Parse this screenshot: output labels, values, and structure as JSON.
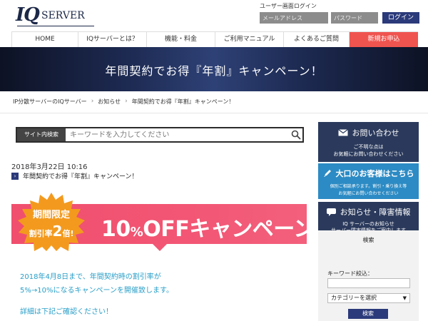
{
  "header": {
    "logo_iq": "IQ",
    "logo_server": "SERVER",
    "login_label": "ユーザー画面ログイン",
    "email_placeholder": "メールアドレス",
    "password_placeholder": "パスワード",
    "login_button": "ログイン"
  },
  "nav": {
    "items": [
      {
        "label": "HOME"
      },
      {
        "label": "IQサーバーとは？"
      },
      {
        "label": "機能・料金"
      },
      {
        "label": "ご利用マニュアル"
      },
      {
        "label": "よくあるご質問"
      },
      {
        "label": "新規お申込"
      }
    ]
  },
  "banner": {
    "title": "年間契約でお得『年割』キャンペーン！"
  },
  "breadcrumb": {
    "items": [
      "IP分散サーバーのIQサーバー",
      "お知らせ",
      "年間契約でお得『年割』キャンペーン！"
    ]
  },
  "search": {
    "label": "サイト内検索",
    "placeholder": "キーワードを入力してください"
  },
  "post": {
    "date": "2018年3月22日 10:16",
    "title": "年間契約でお得『年割』キャンペーン！"
  },
  "campaign": {
    "burst_line1": "期間限定",
    "burst_line2_prefix": "割引率",
    "burst_line2_big": "2",
    "burst_line2_suffix": "倍!",
    "big_number": "10",
    "percent": "%",
    "headline": "OFFキャンペーン!!",
    "colors": {
      "pink": "#f25674",
      "burst": "#f39a1e"
    }
  },
  "description": {
    "line1": "2018年4月8日まで、年間契約時の割引率が",
    "line2": "5%→10%になるキャンペーンを開催致します。",
    "line3": "詳細は下記ご確認ください！"
  },
  "sidebar": {
    "contact": {
      "title": "お問い合わせ",
      "sub1": "ご不明な点は",
      "sub2": "お気軽にお問い合わせください",
      "icon": "mail-icon"
    },
    "large_customer": {
      "title": "大口のお客様はこちら",
      "sub1": "個別ご相談承ります。割引・乗り換え等",
      "sub2": "お気軽にお問い合わせください",
      "icon": "pencil-icon"
    },
    "news": {
      "title": "お知らせ・障害情報",
      "sub1": "IQ サーバーのお知らせ",
      "sub2": "サーバー障害情報をご案内します",
      "icon": "chat-icon"
    },
    "search_box": {
      "title": "検索",
      "keyword_label": "キーワード絞込：",
      "category_selected": "カテゴリーを選択",
      "button": "検索"
    }
  }
}
